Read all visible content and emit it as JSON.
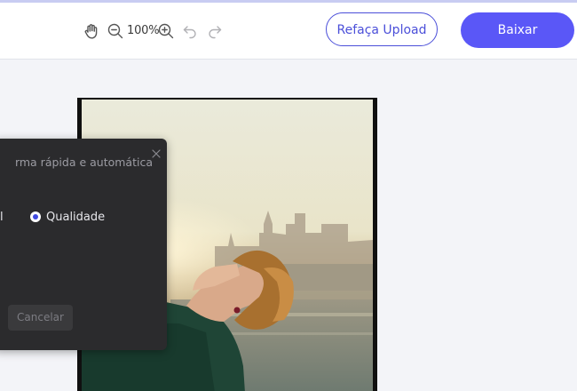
{
  "toolbar": {
    "zoom_level": "100%",
    "reupload_label": "Refaça Upload",
    "download_label": "Baixar",
    "icons": [
      "hand-icon",
      "zoom-out-icon",
      "zoom-in-icon",
      "undo-icon",
      "redo-icon"
    ]
  },
  "dialog": {
    "description": "rma rápida e automática",
    "option_left": "al",
    "option_quality": "Qualidade",
    "cancel_label": "Cancelar"
  },
  "colors": {
    "accent": "#5a57f7",
    "outline_button": "#4b4fd9",
    "dialog_bg": "#2b2b2d",
    "canvas_bg": "#f3f4f8"
  }
}
